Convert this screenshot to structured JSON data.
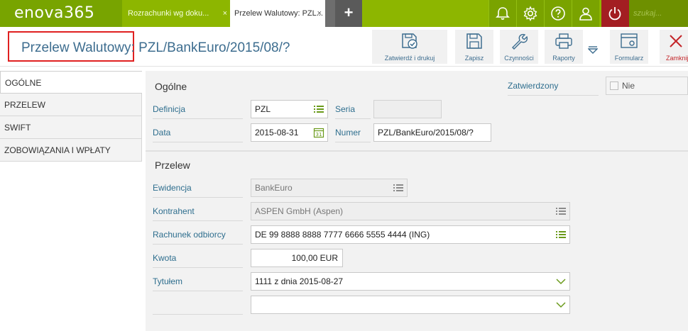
{
  "app": {
    "logo": "enova365"
  },
  "tabs": [
    {
      "label": "Rozrachunki wg doku...",
      "close": "×"
    },
    {
      "label": "Przelew Walutowy: PZL...",
      "close": "×"
    }
  ],
  "topbar": {
    "add_label": "+",
    "search_placeholder": "szukaj..."
  },
  "header": {
    "title": "Przelew Walutowy: PZL/BankEuro/2015/08/?"
  },
  "toolbar": {
    "approve_print": "Zatwierdź i drukuj",
    "save": "Zapisz",
    "actions": "Czynności",
    "reports": "Raporty",
    "form": "Formularz",
    "close": "Zamknij"
  },
  "nav": {
    "items": [
      "OGÓLNE",
      "PRZELEW",
      "SWIFT",
      "ZOBOWIĄZANIA I WPŁATY"
    ]
  },
  "general": {
    "section": "Ogólne",
    "definition_label": "Definicja",
    "definition_value": "PZL",
    "date_label": "Data",
    "date_value": "2015-08-31",
    "series_label": "Seria",
    "series_value": "",
    "number_label": "Numer",
    "number_value": "PZL/BankEuro/2015/08/?",
    "approved_label": "Zatwierdzony",
    "approved_value": "Nie",
    "calendar_day": "31"
  },
  "transfer": {
    "section": "Przelew",
    "register_label": "Ewidencja",
    "register_value": "BankEuro",
    "contractor_label": "Kontrahent",
    "contractor_value": "ASPEN GmbH (Aspen)",
    "account_label": "Rachunek odbiorcy",
    "account_value": "DE 99 8888 8888 7777 6666 5555 4444 (ING)",
    "amount_label": "Kwota",
    "amount_value": "100,00 EUR",
    "title_label": "Tytułem",
    "title_value": "1111 z dnia 2015-08-27",
    "title_value2": ""
  },
  "colors": {
    "accent": "#8db600",
    "power": "#a31e22",
    "link": "#2e6e8e",
    "highlight_box": "#e02020"
  }
}
